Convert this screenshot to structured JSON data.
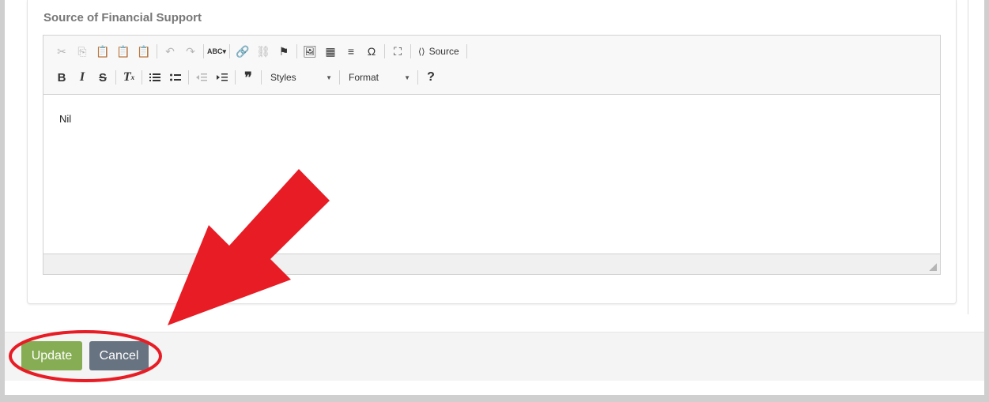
{
  "section": {
    "title": "Source of Financial Support"
  },
  "toolbar": {
    "row1": [
      {
        "icon": "cut-icon",
        "glyph": "✂",
        "disabled": true
      },
      {
        "icon": "copy-icon",
        "glyph": "⎘",
        "disabled": true
      },
      {
        "icon": "paste-icon",
        "glyph": "📋",
        "disabled": false
      },
      {
        "icon": "paste-text-icon",
        "glyph": "📋",
        "disabled": false
      },
      {
        "icon": "paste-word-icon",
        "glyph": "📋",
        "disabled": false
      },
      {
        "sep": true
      },
      {
        "icon": "undo-icon",
        "glyph": "↶",
        "disabled": true
      },
      {
        "icon": "redo-icon",
        "glyph": "↷",
        "disabled": true
      },
      {
        "sep": true
      },
      {
        "icon": "spellcheck-icon",
        "glyph": "ABC▾",
        "disabled": false
      },
      {
        "sep": true
      },
      {
        "icon": "link-icon",
        "glyph": "🔗",
        "disabled": false
      },
      {
        "icon": "unlink-icon",
        "glyph": "⛓",
        "disabled": true
      },
      {
        "icon": "anchor-flag-icon",
        "glyph": "⚑",
        "disabled": false
      },
      {
        "sep": true
      },
      {
        "icon": "image-icon",
        "glyph": "🖼",
        "disabled": false
      },
      {
        "icon": "table-icon",
        "glyph": "▦",
        "disabled": false
      },
      {
        "icon": "horizontal-line-icon",
        "glyph": "≡",
        "disabled": false
      },
      {
        "icon": "special-char-icon",
        "glyph": "Ω",
        "disabled": false
      },
      {
        "sep": true
      },
      {
        "icon": "maximize-icon",
        "glyph": "⛶",
        "disabled": false
      },
      {
        "sep": true
      }
    ],
    "source_label": "Source",
    "styles_label": "Styles",
    "format_label": "Format",
    "help_glyph": "?"
  },
  "editor": {
    "content": "Nil"
  },
  "actions": {
    "update_label": "Update",
    "cancel_label": "Cancel"
  },
  "colors": {
    "update": "#86ad53",
    "cancel": "#687381",
    "annotation": "#e81c24"
  }
}
